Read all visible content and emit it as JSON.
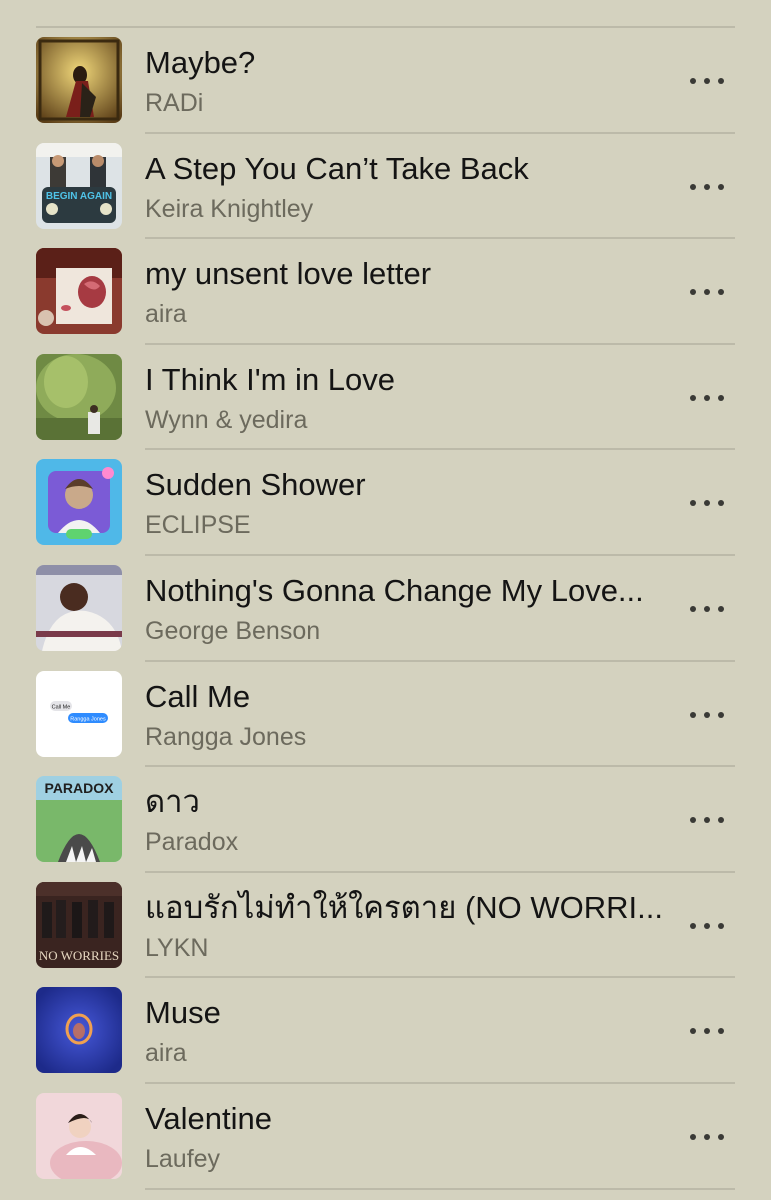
{
  "songs": [
    {
      "title": "Maybe?",
      "artist": "RADi",
      "art": "painting-couple-art"
    },
    {
      "title": "A Step You Can’t Take Back",
      "artist": "Keira Knightley",
      "art": "begin-again-art",
      "art_text": "BEGIN AGAIN"
    },
    {
      "title": "my unsent love letter",
      "artist": "aira",
      "art": "love-letter-art"
    },
    {
      "title": "I Think I'm in Love",
      "artist": "Wynn & yedira",
      "art": "willow-tree-art"
    },
    {
      "title": "Sudden Shower",
      "artist": "ECLIPSE",
      "art": "eclipse-portrait-art"
    },
    {
      "title": "Nothing's Gonna Change My Love...",
      "artist": "George Benson",
      "art": "george-benson-art"
    },
    {
      "title": "Call Me",
      "artist": "Rangga Jones",
      "art": "chat-bubbles-art",
      "art_bubble_left": "Call Me",
      "art_bubble_right": "Rangga Jones"
    },
    {
      "title": "ดาว",
      "artist": "Paradox",
      "art": "paradox-shark-art",
      "art_text": "PARADOX"
    },
    {
      "title": "แอบรักไม่ทำให้ใครตาย (NO WORRI...",
      "artist": "LYKN",
      "art": "no-worries-art",
      "art_text": "NO WORRIES"
    },
    {
      "title": "Muse",
      "artist": "aira",
      "art": "muse-blue-art"
    },
    {
      "title": "Valentine",
      "artist": "Laufey",
      "art": "valentine-pink-art"
    }
  ]
}
